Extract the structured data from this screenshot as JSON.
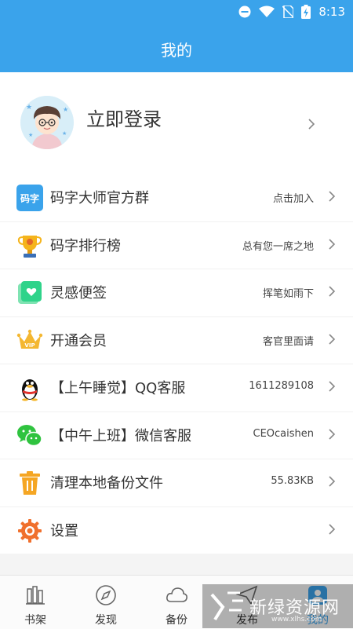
{
  "status_bar": {
    "time": "8:13"
  },
  "header": {
    "title": "我的"
  },
  "profile": {
    "login_text": "立即登录"
  },
  "menu": [
    {
      "label": "码字大师官方群",
      "value": "点击加入",
      "icon": "mazi-logo-icon"
    },
    {
      "label": "码字排行榜",
      "value": "总有您一席之地",
      "icon": "trophy-icon"
    },
    {
      "label": "灵感便签",
      "value": "挥笔如雨下",
      "icon": "note-icon"
    },
    {
      "label": "开通会员",
      "value": "客官里面请",
      "icon": "vip-crown-icon"
    },
    {
      "label": "【上午睡觉】QQ客服",
      "value": "1611289108",
      "icon": "qq-penguin-icon"
    },
    {
      "label": "【中午上班】微信客服",
      "value": "CEOcaishen",
      "icon": "wechat-icon"
    },
    {
      "label": "清理本地备份文件",
      "value": "55.83KB",
      "icon": "trash-icon"
    },
    {
      "label": "设置",
      "value": "",
      "icon": "gear-icon"
    }
  ],
  "mazi_logo_text": "码字",
  "vip_text": "VIP",
  "tabs": [
    {
      "label": "书架",
      "icon": "bookshelf-icon"
    },
    {
      "label": "发现",
      "icon": "compass-icon"
    },
    {
      "label": "备份",
      "icon": "cloud-icon"
    },
    {
      "label": "发布",
      "icon": "send-icon"
    },
    {
      "label": "我的",
      "icon": "profile-icon",
      "active": true
    }
  ],
  "watermark": {
    "text": "新绿资源网",
    "sub": "www.xlhs.com"
  },
  "colors": {
    "primary": "#3aa3eb",
    "text": "#333333",
    "secondary": "#444444"
  }
}
